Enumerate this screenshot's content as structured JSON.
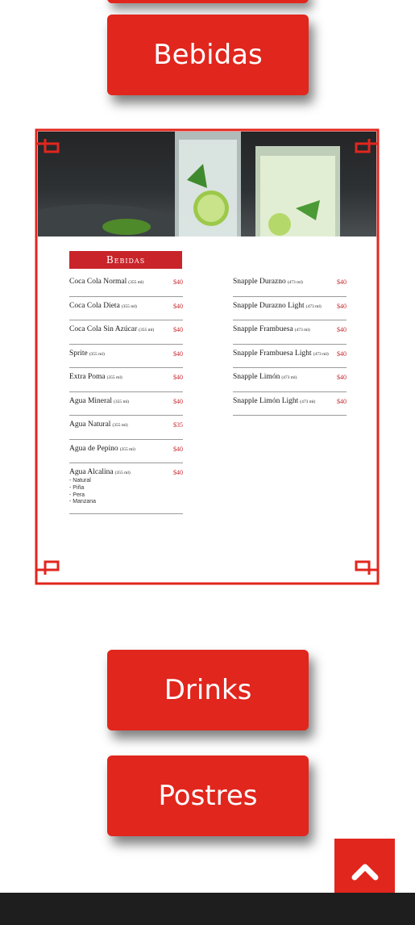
{
  "buttons": {
    "bebidas": "Bebidas",
    "drinks": "Drinks",
    "postres": "Postres"
  },
  "menu": {
    "section_title": "Bebidas",
    "left_items": [
      {
        "name": "Coca Cola Normal",
        "size": "(355 ml)",
        "price": "$40"
      },
      {
        "name": "Coca Cola Dieta",
        "size": "(355 ml)",
        "price": "$40"
      },
      {
        "name": "Coca Cola Sin Azúcar",
        "size": "(355 ml)",
        "price": "$40"
      },
      {
        "name": "Sprite",
        "size": "(355 ml)",
        "price": "$40"
      },
      {
        "name": "Extra Poma",
        "size": "(355 ml)",
        "price": "$40"
      },
      {
        "name": "Agua Mineral",
        "size": "(355 ml)",
        "price": "$40"
      },
      {
        "name": "Agua Natural",
        "size": "(355 ml)",
        "price": "$35"
      },
      {
        "name": "Agua de Pepino",
        "size": "(355 ml)",
        "price": "$40"
      },
      {
        "name": "Agua Alcalina",
        "size": "(355 ml)",
        "price": "$40",
        "options": [
          "- Natural",
          "- Piña",
          "- Pera",
          "- Manzana"
        ]
      }
    ],
    "right_items": [
      {
        "name": "Snapple Durazno",
        "size": "(473 ml)",
        "price": "$40"
      },
      {
        "name": "Snapple Durazno Light",
        "size": "(473 ml)",
        "price": "$40"
      },
      {
        "name": "Snapple Frambuesa",
        "size": "(473 ml)",
        "price": "$40"
      },
      {
        "name": "Snapple Frambuesa Light",
        "size": "(473 ml)",
        "price": "$40"
      },
      {
        "name": "Snapple Limón",
        "size": "(473 ml)",
        "price": "$40"
      },
      {
        "name": "Snapple Limón Light",
        "size": "(473 ml)",
        "price": "$40"
      }
    ]
  },
  "icons": {
    "scroll_top": "chevron-up-icon"
  },
  "colors": {
    "accent": "#e1261d",
    "menu_red": "#c8242a",
    "footer": "#1e1e1e"
  }
}
